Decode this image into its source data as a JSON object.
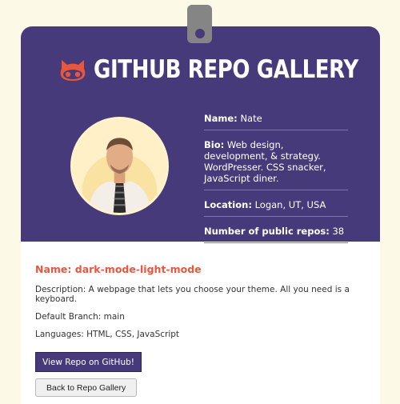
{
  "header": {
    "title": "GitHub Repo Gallery",
    "logo_icon": "octocat-icon"
  },
  "profile": {
    "avatar_icon": "user-avatar",
    "name_label": "Name:",
    "name": "Nate",
    "bio_label": "Bio:",
    "bio": "Web design, development, & strategy. WordPresser. CSS snacker, JavaScript diner.",
    "location_label": "Location:",
    "location": "Logan, UT, USA",
    "repos_label": "Number of public repos:",
    "repos": "38"
  },
  "repo": {
    "name": "Name: dark-mode-light-mode",
    "description": "Description: A webpage that lets you choose your theme. All you need is a keyboard.",
    "branch": "Default Branch: main",
    "languages": "Languages: HTML, CSS, JavaScript",
    "view_button": "View Repo on GitHub!",
    "back_button": "Back to Repo Gallery"
  },
  "colors": {
    "page_bg": "#fcf9e6",
    "header_bg": "#473a7a",
    "accent": "#e8563c",
    "clip": "#858585"
  }
}
